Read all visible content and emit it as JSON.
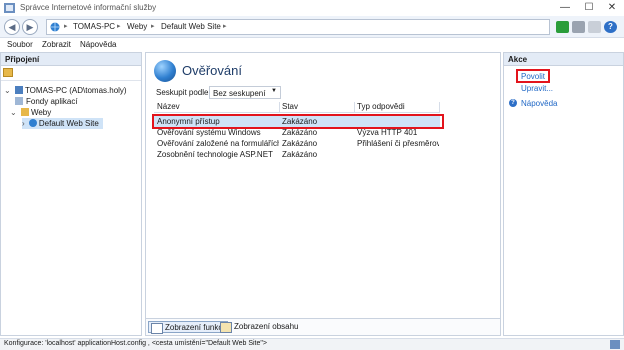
{
  "window": {
    "title": "Správce Internetové informační služby",
    "controls": [
      "—",
      "☐",
      "✕"
    ]
  },
  "address": {
    "segments": [
      "TOMAS-PC",
      "Weby",
      "Default Web Site"
    ]
  },
  "menu": [
    "Soubor",
    "Zobrazit",
    "Nápověda"
  ],
  "connections": {
    "title": "Připojení",
    "tree": [
      {
        "label": "TOMAS-PC (AD\\tomas.holy)",
        "level": 0
      },
      {
        "label": "Fondy aplikací",
        "level": 1
      },
      {
        "label": "Weby",
        "level": 1
      },
      {
        "label": "Default Web Site",
        "level": 2,
        "selected": true
      }
    ]
  },
  "main": {
    "title": "Ověřování",
    "group_label": "Seskupit podle:",
    "group_value": "Bez seskupení",
    "columns": [
      "Název",
      "Stav",
      "Typ odpovědi"
    ],
    "rows": [
      {
        "name": "Anonymní přístup",
        "status": "Zakázáno",
        "type": ""
      },
      {
        "name": "Ověřování systému Windows",
        "status": "Zakázáno",
        "type": "Výzva HTTP 401"
      },
      {
        "name": "Ověřování založené na formulářích",
        "status": "Zakázáno",
        "type": "Přihlášení či přesměrov..."
      },
      {
        "name": "Zosobnění technologie ASP.NET",
        "status": "Zakázáno",
        "type": ""
      }
    ],
    "view_tabs": [
      "Zobrazení funkcí",
      "Zobrazení obsahu"
    ]
  },
  "actions": {
    "title": "Akce",
    "items": [
      "Povolit",
      "Upravit...",
      "Nápověda"
    ]
  },
  "status": {
    "text": "Konfigurace: 'localhost' applicationHost.config , <cesta umístění=\"Default Web Site\">"
  },
  "colors": {
    "highlight": "#e3141c",
    "link": "#1f67c5",
    "selection": "#cfe3f7"
  }
}
